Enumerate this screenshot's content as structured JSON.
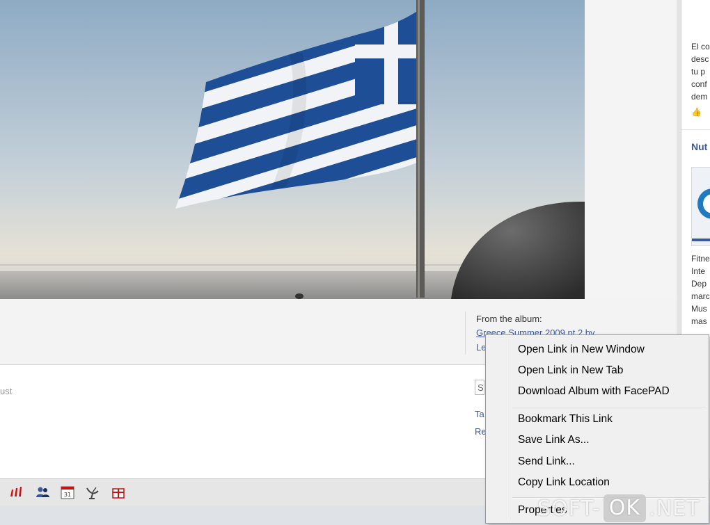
{
  "album": {
    "from_label": "From the album:",
    "album_link": "Greece Summer 2009 pt 2 by",
    "owner_partial": "Le"
  },
  "comment": {
    "partial_text": "ust",
    "input_partial": "S",
    "link_a_partial": "Ta",
    "link_b_partial": "Re"
  },
  "toolbar": {
    "icons": [
      "signal-bars-icon",
      "friends-icon",
      "calendar-icon",
      "satellite-dish-icon",
      "gift-icon"
    ],
    "calendar_day": "31",
    "brand_red": "#cc1111"
  },
  "sidebar": {
    "top_lines": [
      "El co",
      "desc",
      "tu p",
      "conf",
      "dem"
    ],
    "heading": "Nut",
    "bottom_lines": [
      "Fitne",
      "Inte",
      "Dep",
      "marc",
      "Mus",
      "mas"
    ]
  },
  "context_menu": {
    "items": [
      "Open Link in New Window",
      "Open Link in New Tab",
      "Download Album with FacePAD",
      "Bookmark This Link",
      "Save Link As...",
      "Send Link...",
      "Copy Link Location",
      "Properties"
    ]
  },
  "watermark": {
    "left": "SOFT-",
    "box": "OK",
    "right": ".NET"
  }
}
